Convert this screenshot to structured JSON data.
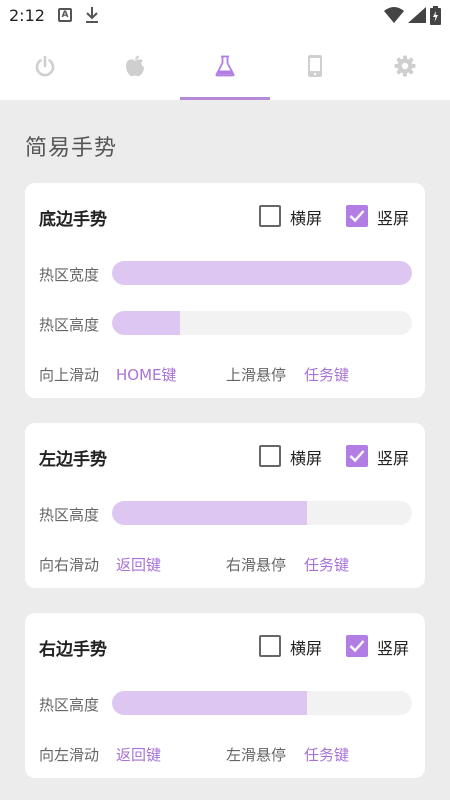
{
  "status": {
    "time": "2:12",
    "notif_letter": "A"
  },
  "tabs": [
    {
      "name": "power",
      "icon": "power-icon"
    },
    {
      "name": "apple",
      "icon": "apple-icon"
    },
    {
      "name": "lab",
      "icon": "flask-icon",
      "active": true
    },
    {
      "name": "phone",
      "icon": "phone-icon"
    },
    {
      "name": "settings",
      "icon": "gear-icon"
    }
  ],
  "page": {
    "title": "简易手势"
  },
  "colors": {
    "accent": "#b37ee3",
    "fill": "#ddc7f2",
    "link": "#a872d8"
  },
  "cards": {
    "bottom": {
      "title": "底边手势",
      "landscape_label": "横屏",
      "landscape_checked": false,
      "portrait_label": "竖屏",
      "portrait_checked": true,
      "width_label": "热区宽度",
      "width_fraction": 1.0,
      "height_label": "热区高度",
      "height_fraction": 0.225,
      "swipe_label": "向上滑动",
      "swipe_value": "HOME键",
      "hover_label": "上滑悬停",
      "hover_value": "任务键"
    },
    "left": {
      "title": "左边手势",
      "landscape_label": "横屏",
      "landscape_checked": false,
      "portrait_label": "竖屏",
      "portrait_checked": true,
      "height_label": "热区高度",
      "height_fraction": 0.65,
      "swipe_label": "向右滑动",
      "swipe_value": "返回键",
      "hover_label": "右滑悬停",
      "hover_value": "任务键"
    },
    "right": {
      "title": "右边手势",
      "landscape_label": "横屏",
      "landscape_checked": false,
      "portrait_label": "竖屏",
      "portrait_checked": true,
      "height_label": "热区高度",
      "height_fraction": 0.65,
      "swipe_label": "向左滑动",
      "swipe_value": "返回键",
      "hover_label": "左滑悬停",
      "hover_value": "任务键"
    }
  }
}
